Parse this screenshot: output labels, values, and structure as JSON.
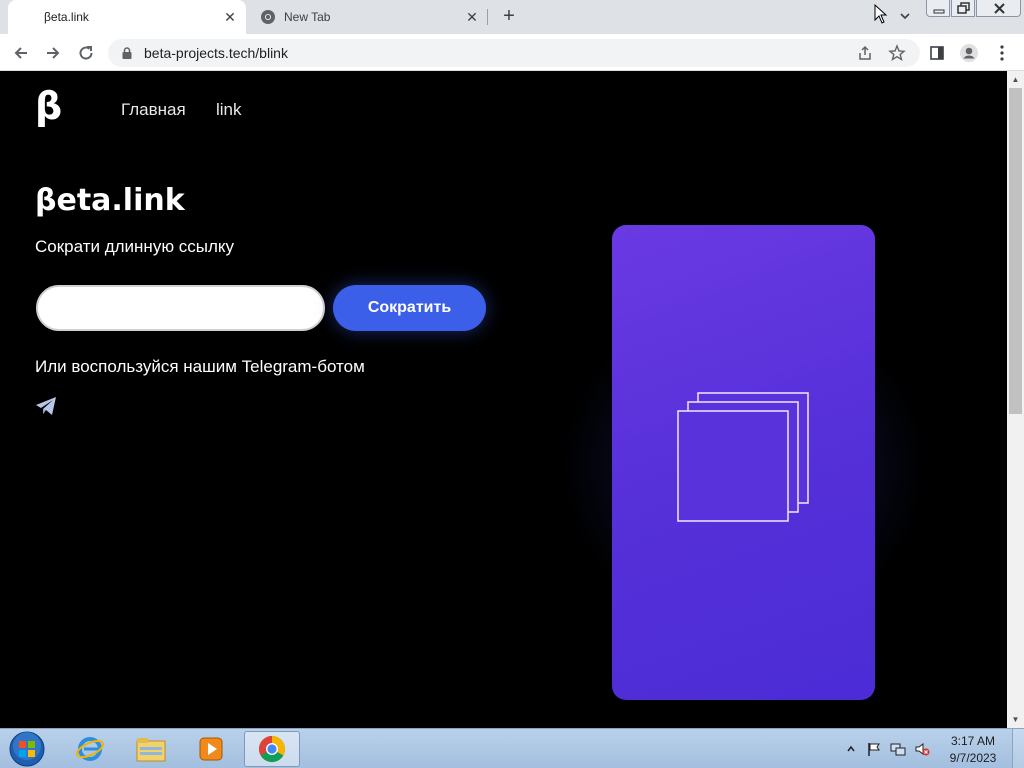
{
  "browser": {
    "tabs": [
      {
        "title": "βeta.link",
        "active": true
      },
      {
        "title": "New Tab",
        "active": false
      }
    ],
    "url": "beta-projects.tech/blink"
  },
  "page": {
    "logo": "β",
    "nav": {
      "home": "Главная",
      "link": "link"
    },
    "title": "βeta.link",
    "subtitle": "Сократи длинную ссылку",
    "input": {
      "value": "",
      "placeholder": ""
    },
    "shorten_button": "Сократить",
    "telegram_text": "Или воспользуйся нашим Telegram-ботом",
    "telegram_icon": "telegram-icon"
  },
  "colors": {
    "page_bg": "#000000",
    "button_bg": "#3b5fe8",
    "card_gradient_start": "#6a3ae3",
    "card_gradient_end": "#4b2cd6"
  },
  "taskbar": {
    "apps": [
      "internet-explorer",
      "file-explorer",
      "media-player",
      "chrome"
    ],
    "time": "3:17 AM",
    "date": "9/7/2023"
  }
}
